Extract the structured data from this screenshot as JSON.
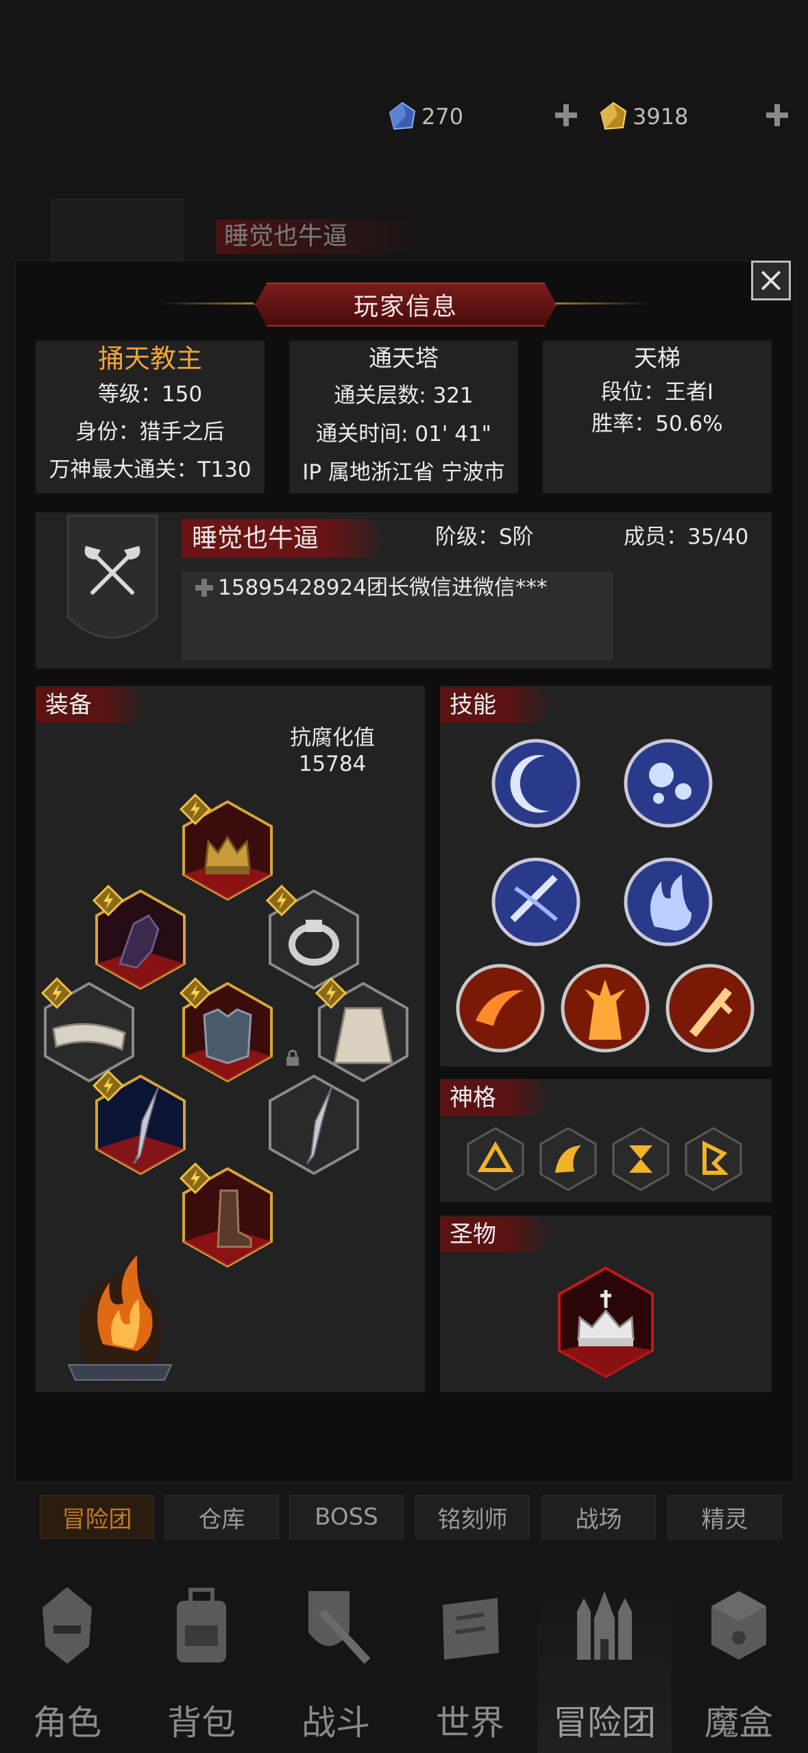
{
  "currency": {
    "blue": "270",
    "gold": "3918"
  },
  "background": {
    "name": "睡觉也牛逼"
  },
  "modal": {
    "title": "玩家信息"
  },
  "profile": {
    "title": "捅天教主",
    "level": "等级：150",
    "identity": "身份：猎手之后",
    "max_clear": "万神最大通关：T130"
  },
  "tower": {
    "title": "通天塔",
    "floors": "通关层数: 321",
    "time": "通关时间: 01' 41\"",
    "ip": "IP 属地浙江省 宁波市"
  },
  "ladder": {
    "title": "天梯",
    "rank": "段位：王者I",
    "winrate": "胜率：50.6%"
  },
  "guild": {
    "name": "睡觉也牛逼",
    "tier": "阶级：S阶",
    "members": "成员：35/40",
    "notice": "15895428924团长微信进微信***"
  },
  "equipment": {
    "header": "装备",
    "resist_label": "抗腐化值",
    "resist_value": "15784"
  },
  "skills": {
    "header": "技能"
  },
  "divinity": {
    "header": "神格"
  },
  "relic": {
    "header": "圣物"
  },
  "subtabs": [
    "冒险团",
    "仓库",
    "BOSS",
    "铭刻师",
    "战场",
    "精灵"
  ],
  "nav": [
    "角色",
    "背包",
    "战斗",
    "世界",
    "冒险团",
    "魔盒"
  ],
  "colors": {
    "accent_red": "#6a1414",
    "title_orange": "#f2a43a",
    "panel": "#222222"
  }
}
